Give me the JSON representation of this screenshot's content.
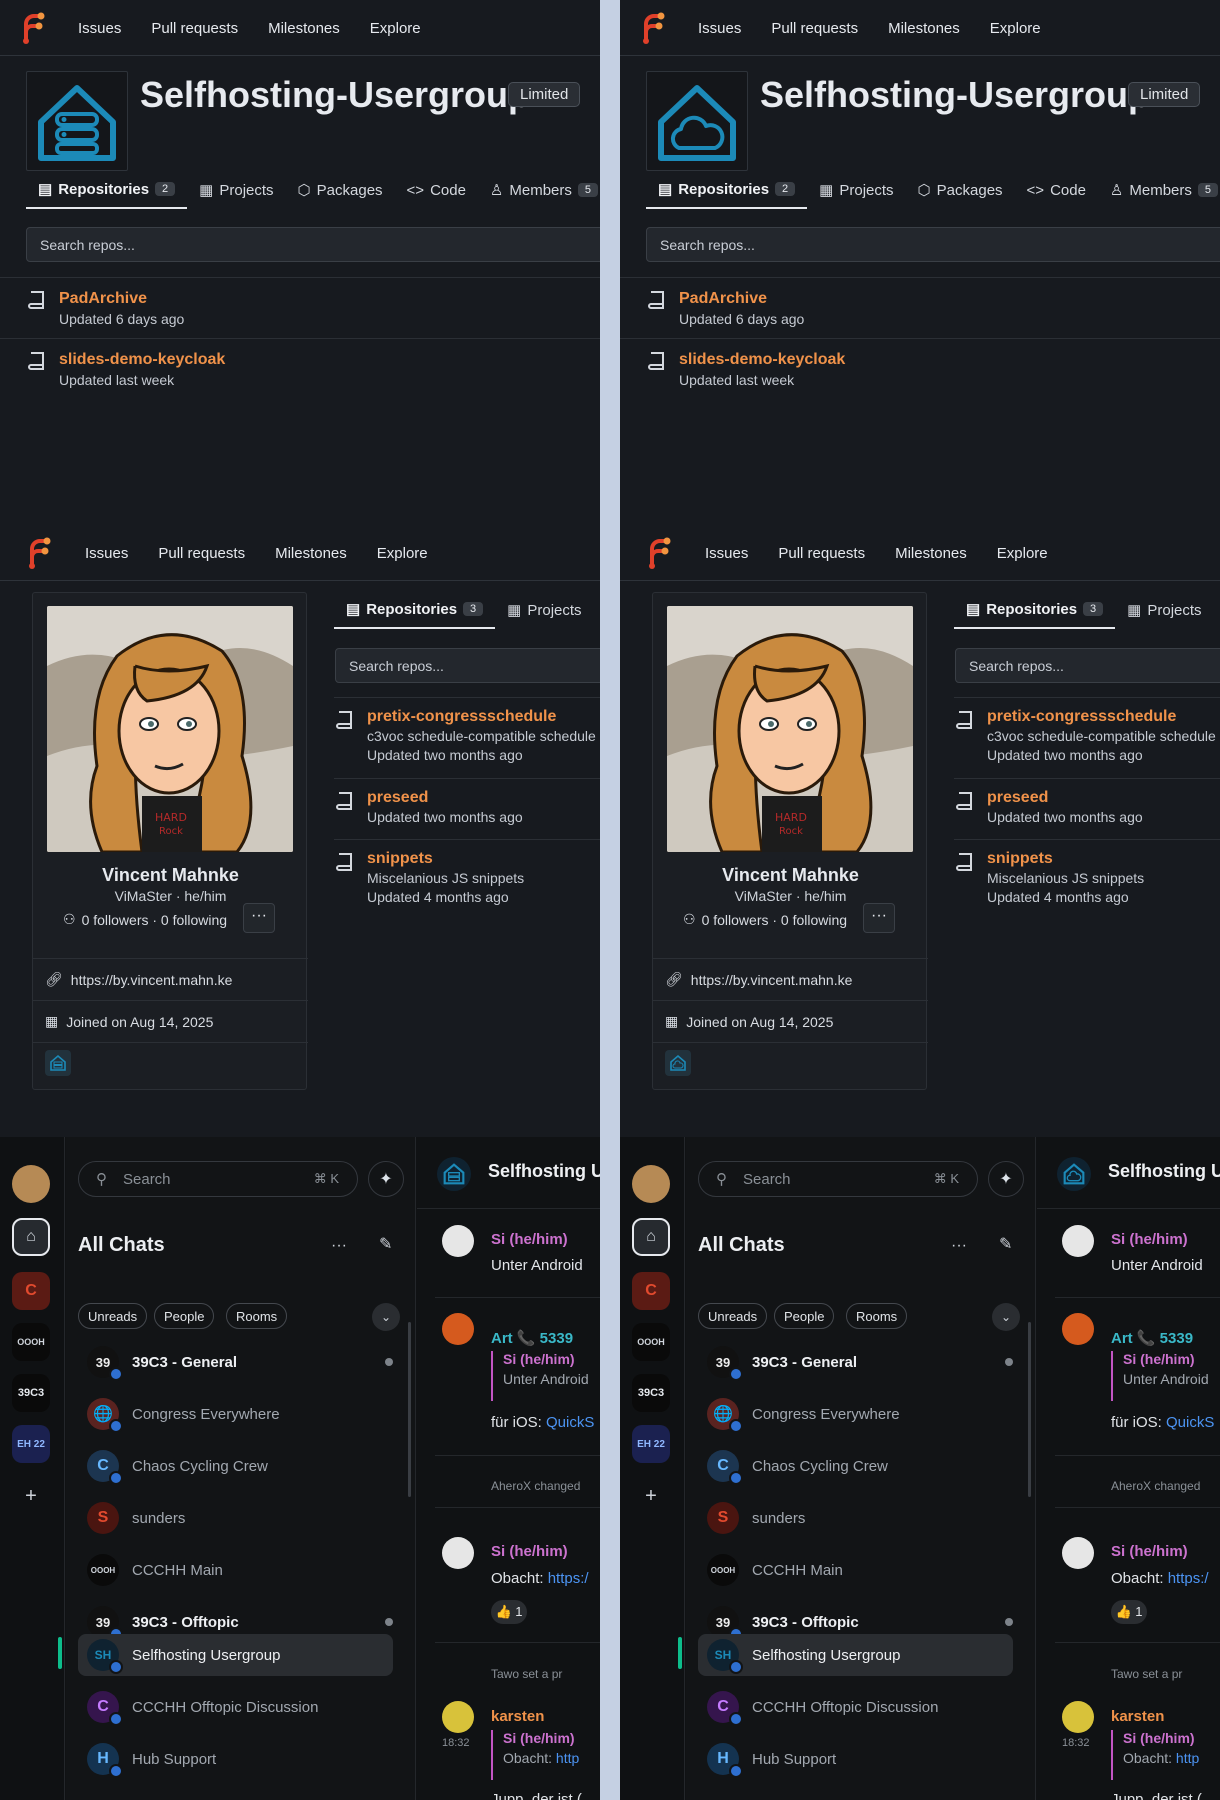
{
  "forge": {
    "nav": [
      "Issues",
      "Pull requests",
      "Milestones",
      "Explore"
    ],
    "org": {
      "name": "Selfhosting-Usergroup",
      "badge": "Limited",
      "tabs": [
        {
          "label": "Repositories",
          "count": "2"
        },
        {
          "label": "Projects"
        },
        {
          "label": "Packages"
        },
        {
          "label": "Code"
        },
        {
          "label": "Members",
          "count": "5"
        }
      ],
      "search_placeholder": "Search repos...",
      "repos": [
        {
          "name": "PadArchive",
          "updated": "Updated 6 days ago"
        },
        {
          "name": "slides-demo-keycloak",
          "updated": "Updated last week"
        }
      ]
    },
    "user": {
      "name": "Vincent Mahnke",
      "handle": "ViMaSter · he/him",
      "followers": "0 followers · 0 following",
      "more": "···",
      "website": "https://by.vincent.mahn.ke",
      "joined": "Joined on Aug 14, 2025",
      "tabs": [
        {
          "label": "Repositories",
          "count": "3"
        },
        {
          "label": "Projects"
        }
      ],
      "search_placeholder": "Search repos...",
      "repos": [
        {
          "name": "pretix-congressschedule",
          "desc": "c3voc schedule-compatible schedule",
          "updated": "Updated two months ago"
        },
        {
          "name": "preseed",
          "desc": "",
          "updated": "Updated two months ago"
        },
        {
          "name": "snippets",
          "desc": "Miscelanious JS snippets",
          "updated": "Updated 4 months ago"
        }
      ]
    }
  },
  "chat": {
    "search_placeholder": "Search",
    "shortcut": "⌘ K",
    "title": "All Chats",
    "more": "···",
    "filters": [
      "Unreads",
      "People",
      "Rooms"
    ],
    "rail": [
      "C",
      "OOOH",
      "39C3",
      "EH 22"
    ],
    "rooms": [
      {
        "name": "39C3 - General",
        "initial": "39",
        "color": "#111111",
        "bold": true,
        "unread": true
      },
      {
        "name": "Congress Everywhere",
        "initial": "🌐",
        "color": "#5a2320"
      },
      {
        "name": "Chaos Cycling Crew",
        "initial": "C",
        "color": "#1c3550"
      },
      {
        "name": "sunders",
        "initial": "S",
        "color": "#4a1510"
      },
      {
        "name": "CCCHH Main",
        "initial": "OOOH",
        "color": "#0a0a0a"
      },
      {
        "name": "39C3 - Offtopic",
        "initial": "39",
        "color": "#111111",
        "bold": true,
        "unread": true
      },
      {
        "name": "Selfhosting Usergroup",
        "initial": "SH",
        "color": "#0f2230",
        "selected": true
      },
      {
        "name": "CCCHH Offtopic Discussion",
        "initial": "C",
        "color": "#35154d"
      },
      {
        "name": "Hub Support",
        "initial": "H",
        "color": "#143350"
      }
    ],
    "room_title": "Selfhosting Usergroup",
    "messages": [
      {
        "sender": "Si (he/him)",
        "text": "Unter Android"
      },
      {
        "sender": "Art 📞 5339",
        "quote_sender": "Si (he/him)",
        "quote_text": "Unter Android",
        "text_prefix": "für iOS: ",
        "link": "QuickS"
      },
      {
        "event": "AheroX changed"
      },
      {
        "sender": "Si (he/him)",
        "text_prefix": "Obacht: ",
        "link": "https:/",
        "reaction": "👍 1"
      },
      {
        "event": "Tawo set a pr"
      },
      {
        "sender": "karsten",
        "time": "18:32",
        "quote_sender": "Si (he/him)",
        "quote_text_prefix": "Obacht: ",
        "quote_link": "http",
        "text": "Jupp, der ist (..."
      }
    ]
  }
}
